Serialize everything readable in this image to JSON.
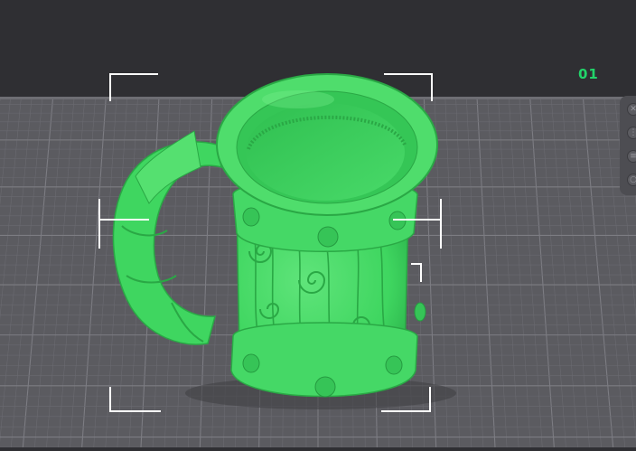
{
  "plate": {
    "label": "01"
  },
  "colors": {
    "background": "#2f2f33",
    "bed": "#5b5b60",
    "grid_major": "#7c7c82",
    "grid_minor": "#6a6a70",
    "model": "#3fd660",
    "model_shadow": "#24a344",
    "model_highlight": "#79ee8d",
    "selection_bracket": "#ffffff",
    "plate_label": "#22d46a"
  },
  "model": {
    "name": "mug-model",
    "selected": true
  },
  "toolbar": {
    "buttons": [
      {
        "name": "close-icon",
        "glyph": "✕"
      },
      {
        "name": "dots-icon",
        "glyph": "⋮"
      },
      {
        "name": "layers-icon",
        "glyph": "≡"
      },
      {
        "name": "circle-icon",
        "glyph": "○"
      }
    ]
  }
}
